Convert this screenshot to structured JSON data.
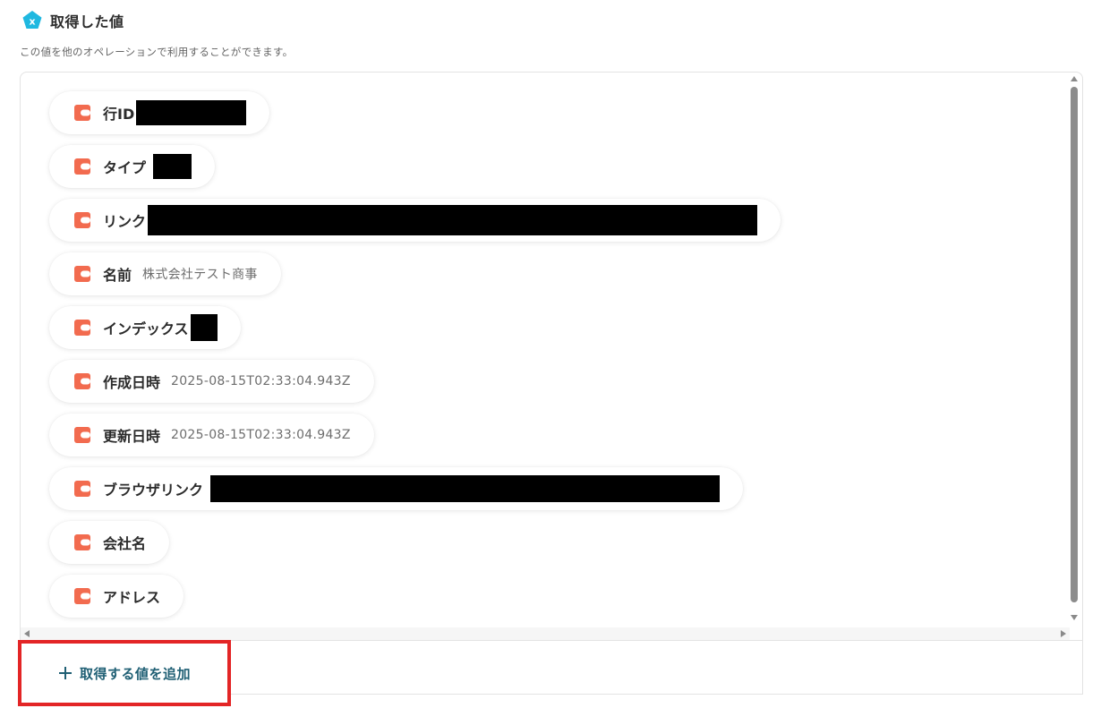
{
  "header": {
    "title": "取得した値",
    "icon": "x-badge-icon",
    "icon_color": "#1fb8e0"
  },
  "subtitle": "この値を他のオペレーションで利用することができます。",
  "items": [
    {
      "label": "行ID",
      "value": ""
    },
    {
      "label": "タイプ",
      "value": ""
    },
    {
      "label": "リンク",
      "value": ""
    },
    {
      "label": "名前",
      "value": "株式会社テスト商事"
    },
    {
      "label": "インデックス",
      "value": ""
    },
    {
      "label": "作成日時",
      "value": "2025-08-15T02:33:04.943Z"
    },
    {
      "label": "更新日時",
      "value": "2025-08-15T02:33:04.943Z"
    },
    {
      "label": "ブラウザリンク",
      "value": ""
    },
    {
      "label": "会社名",
      "value": ""
    },
    {
      "label": "アドレス",
      "value": ""
    }
  ],
  "item_icon": "coda-doc-icon",
  "item_icon_color": "#f26b4f",
  "add_button": {
    "label": "取得する値を追加",
    "icon": "plus-icon",
    "highlight_color": "#e32526"
  }
}
